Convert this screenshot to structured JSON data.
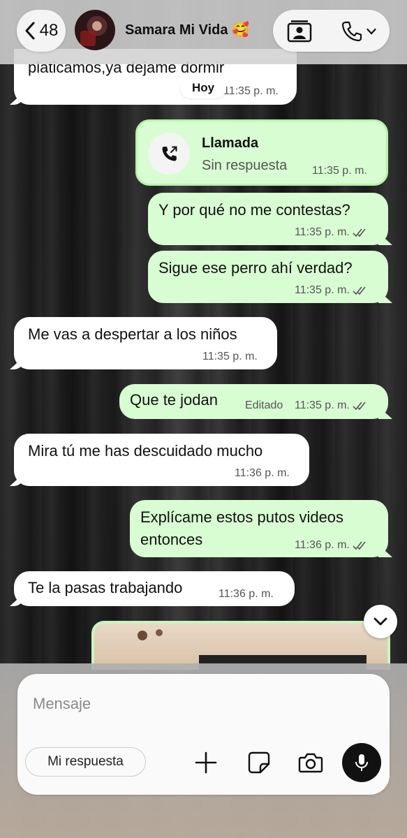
{
  "header": {
    "back_count": "48",
    "contact_name": "Samara Mi Vida 🥰"
  },
  "date_chip": "Hoy",
  "messages": [
    {
      "dir": "in",
      "text": "platicamos,ya dejame dormir",
      "time": "11:35 p. m."
    },
    {
      "dir": "out",
      "type": "call",
      "title": "Llamada",
      "subtitle": "Sin respuesta",
      "time": "11:35 p. m."
    },
    {
      "dir": "out",
      "text": "Y por qué no me contestas?",
      "time": "11:35 p. m."
    },
    {
      "dir": "out",
      "text": "Sigue ese perro ahí verdad?",
      "time": "11:35 p. m."
    },
    {
      "dir": "in",
      "text": "Me vas a despertar a los niños",
      "time": "11:35 p. m."
    },
    {
      "dir": "out",
      "text": "Que te jodan",
      "edited": "Editado",
      "time": "11:35 p. m."
    },
    {
      "dir": "in",
      "text": "Mira tú me has descuidado mucho",
      "time": "11:36 p. m."
    },
    {
      "dir": "out",
      "text_lines": [
        "Explícame estos putos videos",
        "entonces"
      ],
      "time": "11:36 p. m."
    },
    {
      "dir": "in",
      "text": "Te la pasas trabajando",
      "time": "11:36 p. m."
    }
  ],
  "composer": {
    "placeholder": "Mensaje",
    "quick_reply": "Mi respuesta"
  },
  "colors": {
    "outgoing_bubble": "#d8fdd2",
    "incoming_bubble": "#ffffff",
    "read_ticks": "#555555"
  },
  "icons": [
    "chevron-left-icon",
    "contact-card-icon",
    "phone-icon",
    "chevron-down-icon",
    "missed-call-icon",
    "double-check-icon",
    "plus-icon",
    "sticker-icon",
    "camera-icon",
    "microphone-icon"
  ]
}
